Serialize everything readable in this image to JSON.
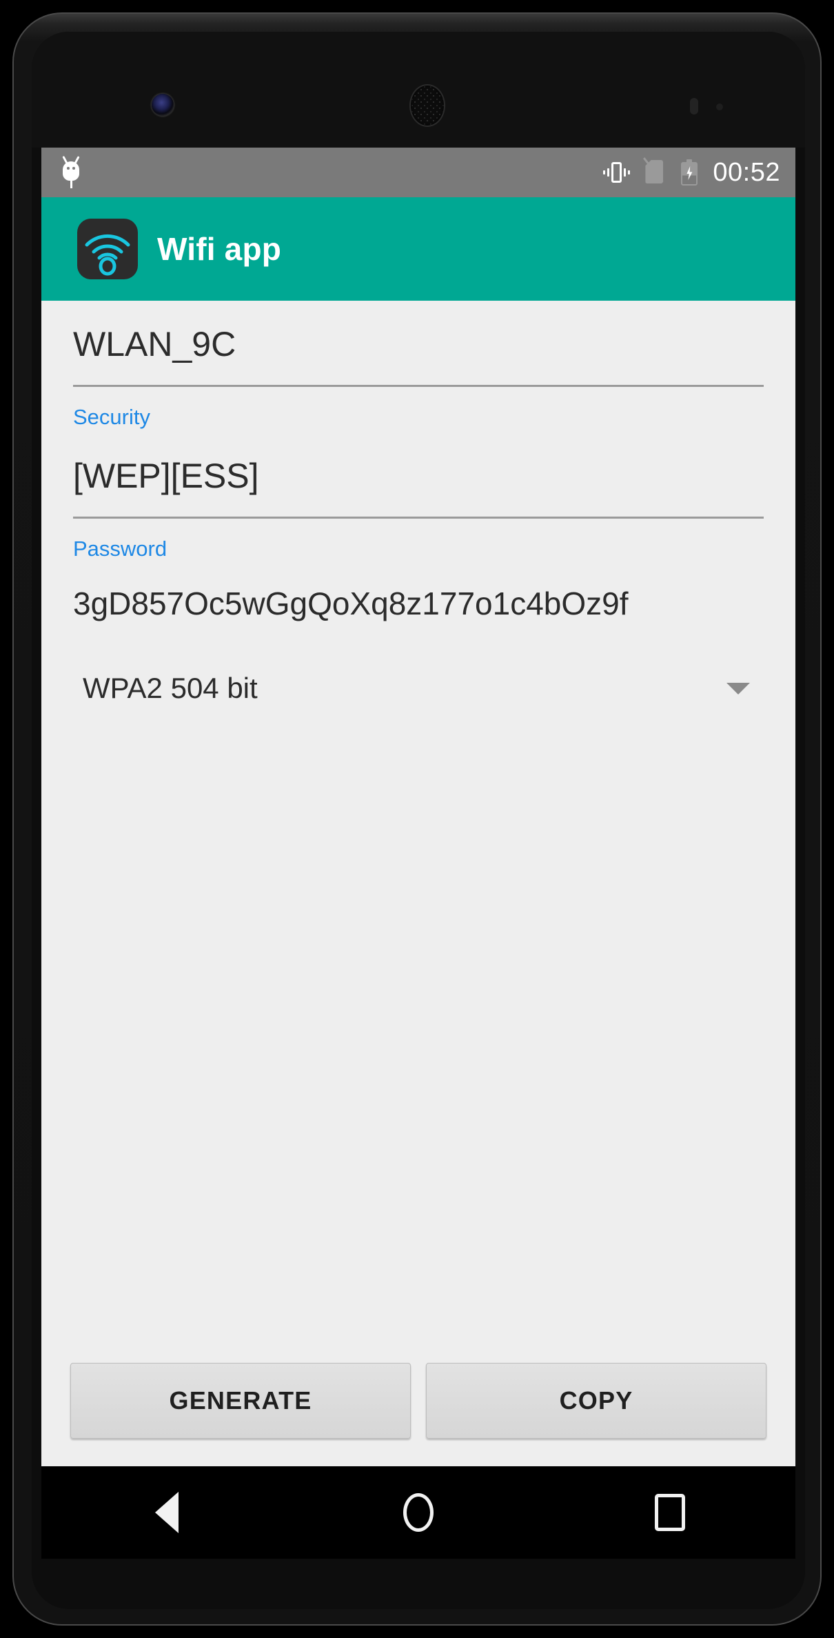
{
  "status_bar": {
    "android_icon": "android-head-icon",
    "vibrate_icon": "vibrate-icon",
    "sim_icon": "no-sim-icon",
    "battery_icon": "battery-charging-icon",
    "time": "00:52"
  },
  "app_bar": {
    "icon": "wifi-app-icon",
    "title": "Wifi app",
    "background_color": "#00a893"
  },
  "form": {
    "ssid": {
      "value": "WLAN_9C"
    },
    "security": {
      "label": "Security",
      "value": "[WEP][ESS]"
    },
    "password": {
      "label": "Password",
      "value": "3gD857Oc5wGgQoXq8z177o1c4bOz9f"
    },
    "strength": {
      "selected": "WPA2 504 bit",
      "caret_icon": "chevron-down-icon"
    }
  },
  "buttons": {
    "generate": "GENERATE",
    "copy": "COPY"
  },
  "nav_bar": {
    "back": "back-triangle-icon",
    "home": "home-circle-icon",
    "recents": "recents-square-icon"
  },
  "colors": {
    "accent": "#00a893",
    "label_blue": "#1e88e5",
    "screen_bg": "#eeeeee",
    "statusbar_bg": "#7a7a7a"
  }
}
